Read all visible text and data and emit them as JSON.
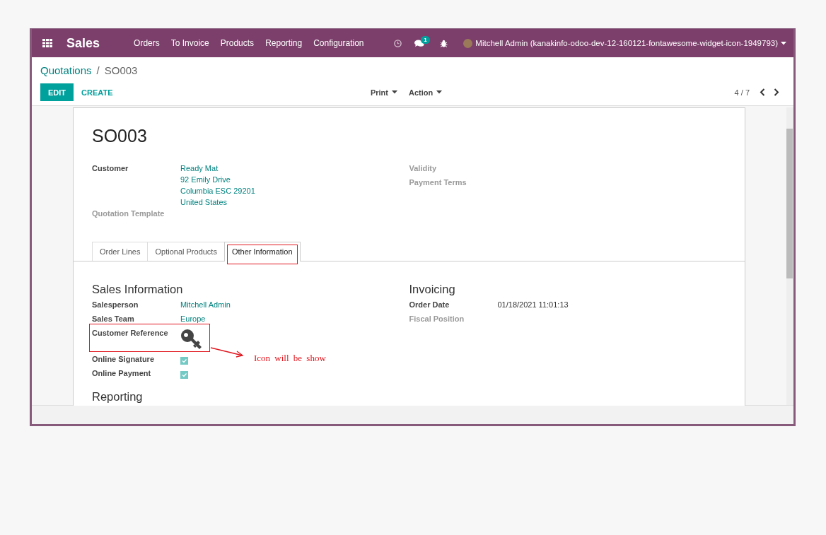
{
  "navbar": {
    "app_name": "Sales",
    "menu": [
      "Orders",
      "To Invoice",
      "Products",
      "Reporting",
      "Configuration"
    ],
    "messages_count": "1",
    "user": "Mitchell Admin (kanakinfo-odoo-dev-12-160121-fontawesome-widget-icon-1949793)"
  },
  "breadcrumb": {
    "parent": "Quotations",
    "separator": "/",
    "current": "SO003"
  },
  "buttons": [
    {
      "label": "EDIT",
      "kind": "primary"
    },
    {
      "label": "CREATE",
      "kind": "link"
    }
  ],
  "dropdowns": [
    "Print",
    "Action"
  ],
  "pager": "4 / 7",
  "form": {
    "title": "SO003",
    "left_fields": [
      {
        "label": "Customer",
        "lines": [
          "Ready Mat",
          "92 Emily Drive",
          "Columbia ESC 29201",
          "United States"
        ]
      },
      {
        "label": "Quotation Template"
      }
    ],
    "right_fields": [
      {
        "label": "Validity"
      },
      {
        "label": "Payment Terms"
      }
    ],
    "tabs": [
      {
        "label": "Order Lines",
        "selected": false,
        "highlighted": false
      },
      {
        "label": "Optional Products",
        "selected": false,
        "highlighted": false
      },
      {
        "label": "Other Information",
        "selected": true,
        "highlighted": true
      }
    ],
    "sales_info": {
      "title": "Sales Information",
      "fields": [
        {
          "label": "Salesperson",
          "kind": "link",
          "value": "Mitchell Admin"
        },
        {
          "label": "Sales Team",
          "kind": "link",
          "value": "Europe"
        },
        {
          "label": "Customer Reference",
          "kind": "icon",
          "highlighted": true
        },
        {
          "label": "Online Signature",
          "kind": "checkbox",
          "checked": true
        },
        {
          "label": "Online Payment",
          "kind": "checkbox",
          "checked": true
        }
      ]
    },
    "invoicing": {
      "title": "Invoicing",
      "fields": [
        {
          "label": "Order Date",
          "kind": "text",
          "value": "01/18/2021 11:01:13"
        },
        {
          "label": "Fiscal Position",
          "kind": "empty"
        }
      ]
    },
    "next_section": "Reporting"
  },
  "annotation": {
    "text": "Icon will be show"
  }
}
